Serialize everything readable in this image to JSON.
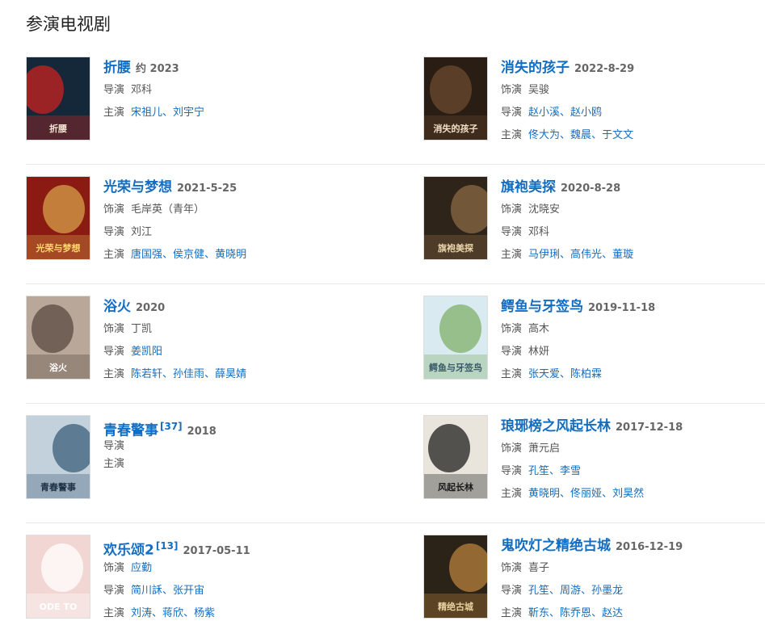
{
  "section_title": "参演电视剧",
  "labels": {
    "role": "饰演",
    "director": "导演",
    "cast": "主演"
  },
  "sep": "、",
  "works": [
    {
      "title": "折腰",
      "date": "约 2023",
      "ref": "",
      "poster": {
        "bg": "#15283a",
        "accent": "#c8211f",
        "text": "#f2e6d0",
        "label": "折腰"
      },
      "role": null,
      "role_link": false,
      "director": [
        "邓科"
      ],
      "director_link": false,
      "cast": [
        "宋祖儿",
        "刘宇宁"
      ]
    },
    {
      "title": "消失的孩子",
      "date": "2022-8-29",
      "ref": "",
      "poster": {
        "bg": "#2a1d14",
        "accent": "#6b4a2e",
        "text": "#f0e2c8",
        "label": "消失的孩子"
      },
      "role": "吴骏",
      "role_link": false,
      "director": [
        "赵小溪",
        "赵小鸥"
      ],
      "director_link": true,
      "cast": [
        "佟大为",
        "魏晨",
        "于文文"
      ]
    },
    {
      "title": "光荣与梦想",
      "date": "2021-5-25",
      "ref": "",
      "poster": {
        "bg": "#8b1b12",
        "accent": "#d7a04a",
        "text": "#ffd86b",
        "label": "光荣与梦想"
      },
      "role": "毛岸英（青年）",
      "role_link": false,
      "director": [
        "刘江"
      ],
      "director_link": false,
      "cast": [
        "唐国强",
        "侯京健",
        "黄晓明"
      ]
    },
    {
      "title": "旗袍美探",
      "date": "2020-8-28",
      "ref": "",
      "poster": {
        "bg": "#2f2419",
        "accent": "#8a6a44",
        "text": "#e8d3a8",
        "label": "旗袍美探"
      },
      "role": "沈晓安",
      "role_link": false,
      "director": [
        "邓科"
      ],
      "director_link": false,
      "cast": [
        "马伊琍",
        "高伟光",
        "董璇"
      ]
    },
    {
      "title": "浴火",
      "date": "2020",
      "ref": "",
      "poster": {
        "bg": "#b9a89a",
        "accent": "#5a4a40",
        "text": "#ffffff",
        "label": "浴火"
      },
      "role": "丁凯",
      "role_link": false,
      "director": [
        "姜凯阳"
      ],
      "director_link": true,
      "cast": [
        "陈若轩",
        "孙佳雨",
        "薛昊婧"
      ]
    },
    {
      "title": "鳄鱼与牙签鸟",
      "date": "2019-11-18",
      "ref": "",
      "poster": {
        "bg": "#d9eaf0",
        "accent": "#7fb06a",
        "text": "#3a5a6a",
        "label": "鳄鱼与牙签鸟"
      },
      "role": "高木",
      "role_link": false,
      "director": [
        "林妍"
      ],
      "director_link": false,
      "cast": [
        "张天爱",
        "陈柏霖"
      ]
    },
    {
      "title": "青春警事",
      "date": "2018",
      "ref": "[37]",
      "poster": {
        "bg": "#c3d1dc",
        "accent": "#3b5d7a",
        "text": "#1f3346",
        "label": "青春警事"
      },
      "role": null,
      "role_link": false,
      "director": [],
      "director_link": false,
      "cast": []
    },
    {
      "title": "琅琊榜之风起长林",
      "date": "2017-12-18",
      "ref": "",
      "poster": {
        "bg": "#e9e5dc",
        "accent": "#1f1f1f",
        "text": "#1a1a1a",
        "label": "风起长林"
      },
      "role": "萧元启",
      "role_link": false,
      "director": [
        "孔笙",
        "李雪"
      ],
      "director_link": true,
      "cast": [
        "黄晓明",
        "佟丽娅",
        "刘昊然"
      ]
    },
    {
      "title": "欢乐颂2",
      "date": "2017-05-11",
      "ref": "[13]",
      "poster": {
        "bg": "#f2d6d3",
        "accent": "#ffffff",
        "text": "#ffffff",
        "label": "ODE TO"
      },
      "role": "应勤",
      "role_link": true,
      "director": [
        "简川訸",
        "张开宙"
      ],
      "director_link": true,
      "cast": [
        "刘涛",
        "蒋欣",
        "杨紫"
      ]
    },
    {
      "title": "鬼吹灯之精绝古城",
      "date": "2016-12-19",
      "ref": "",
      "poster": {
        "bg": "#2b2218",
        "accent": "#b7803c",
        "text": "#e9d2a0",
        "label": "精绝古城"
      },
      "role": "喜子",
      "role_link": false,
      "director": [
        "孔笙",
        "周游",
        "孙墨龙"
      ],
      "director_link": true,
      "cast": [
        "靳东",
        "陈乔恩",
        "赵达"
      ]
    }
  ]
}
